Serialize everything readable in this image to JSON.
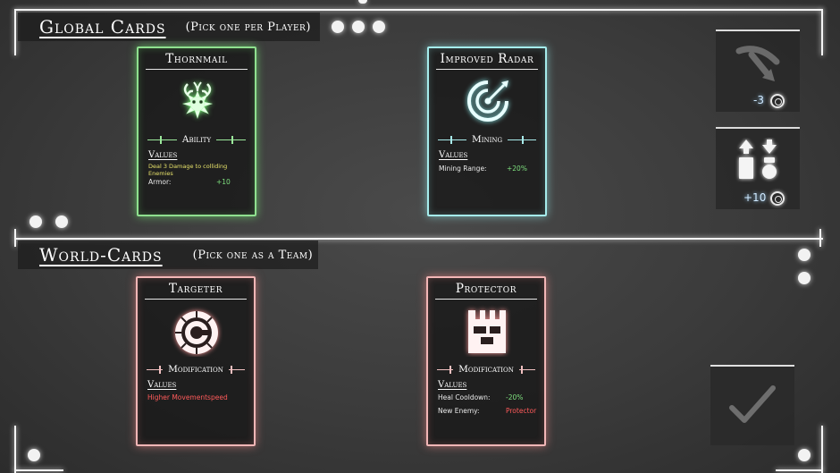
{
  "global_section": {
    "title": "Global Cards",
    "subtitle": "(Pick one per Player)"
  },
  "world_section": {
    "title": "World-Cards",
    "subtitle": "(Pick one as a Team)"
  },
  "cards": {
    "thornmail": {
      "title": "Thornmail",
      "icon": "thorn-creature-icon",
      "type": "Ability",
      "values_label": "Values",
      "description": "Deal 3 Damage to colliding Enemies",
      "stat_name": "Armor:",
      "stat_value": "+10",
      "glow_color": "#8fe08f"
    },
    "improved_radar": {
      "title": "Improved Radar",
      "icon": "radar-icon",
      "type": "Mining",
      "values_label": "Values",
      "stat_name": "Mining Range:",
      "stat_value": "+20%",
      "glow_color": "#a5ecec"
    },
    "targeter": {
      "title": "Targeter",
      "icon": "target-icon",
      "type": "Modification",
      "values_label": "Values",
      "description": "Higher Movementspeed",
      "glow_color": "#f2b6b6"
    },
    "protector": {
      "title": "Protector",
      "icon": "tower-icon",
      "type": "Modification",
      "values_label": "Values",
      "stat1_name": "Heal Cooldown:",
      "stat1_value": "-20%",
      "stat2_name": "New Enemy:",
      "stat2_value": "Protector",
      "glow_color": "#f2b6b6"
    }
  },
  "side_panel": {
    "reroll_cost": "-3",
    "reroll_icon": "reroll-arrow-icon",
    "swap_reward": "+10",
    "swap_icon": "swap-arrows-icon",
    "currency_icon": "gear-coin-icon"
  },
  "confirm": {
    "icon": "checkmark-icon"
  }
}
